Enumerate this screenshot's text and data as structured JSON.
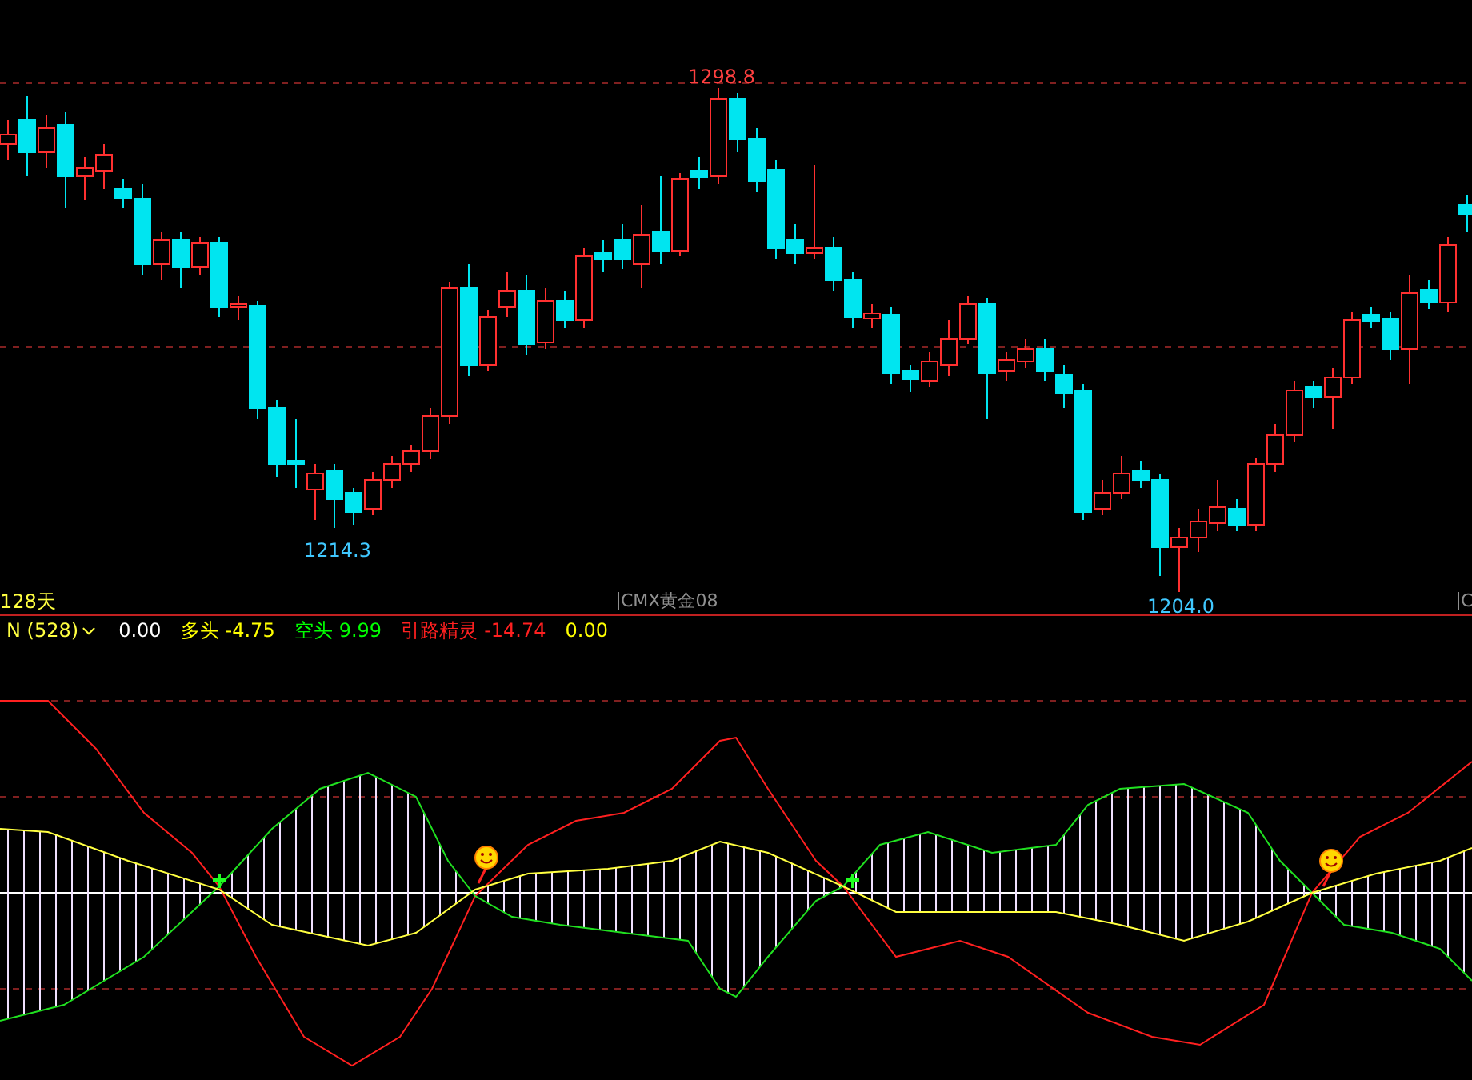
{
  "price_panel": {
    "high_label": "1298.8",
    "low_labels": [
      "1214.3",
      "1204.0"
    ],
    "period_label": "128天",
    "instrument_label": "CMX黄金08",
    "edge_label": "C"
  },
  "indicator_bar": {
    "name": "N (528)",
    "items": [
      {
        "value": "0.00",
        "color": "#ffffff"
      },
      {
        "label": "多头",
        "value": "-4.75",
        "color": "#ffff00"
      },
      {
        "label": "空头",
        "value": "9.99",
        "color": "#00ff00"
      },
      {
        "label": "引路精灵",
        "value": "-14.74",
        "color": "#ff2020"
      },
      {
        "value": "0.00",
        "color": "#ffff00"
      }
    ]
  }
}
